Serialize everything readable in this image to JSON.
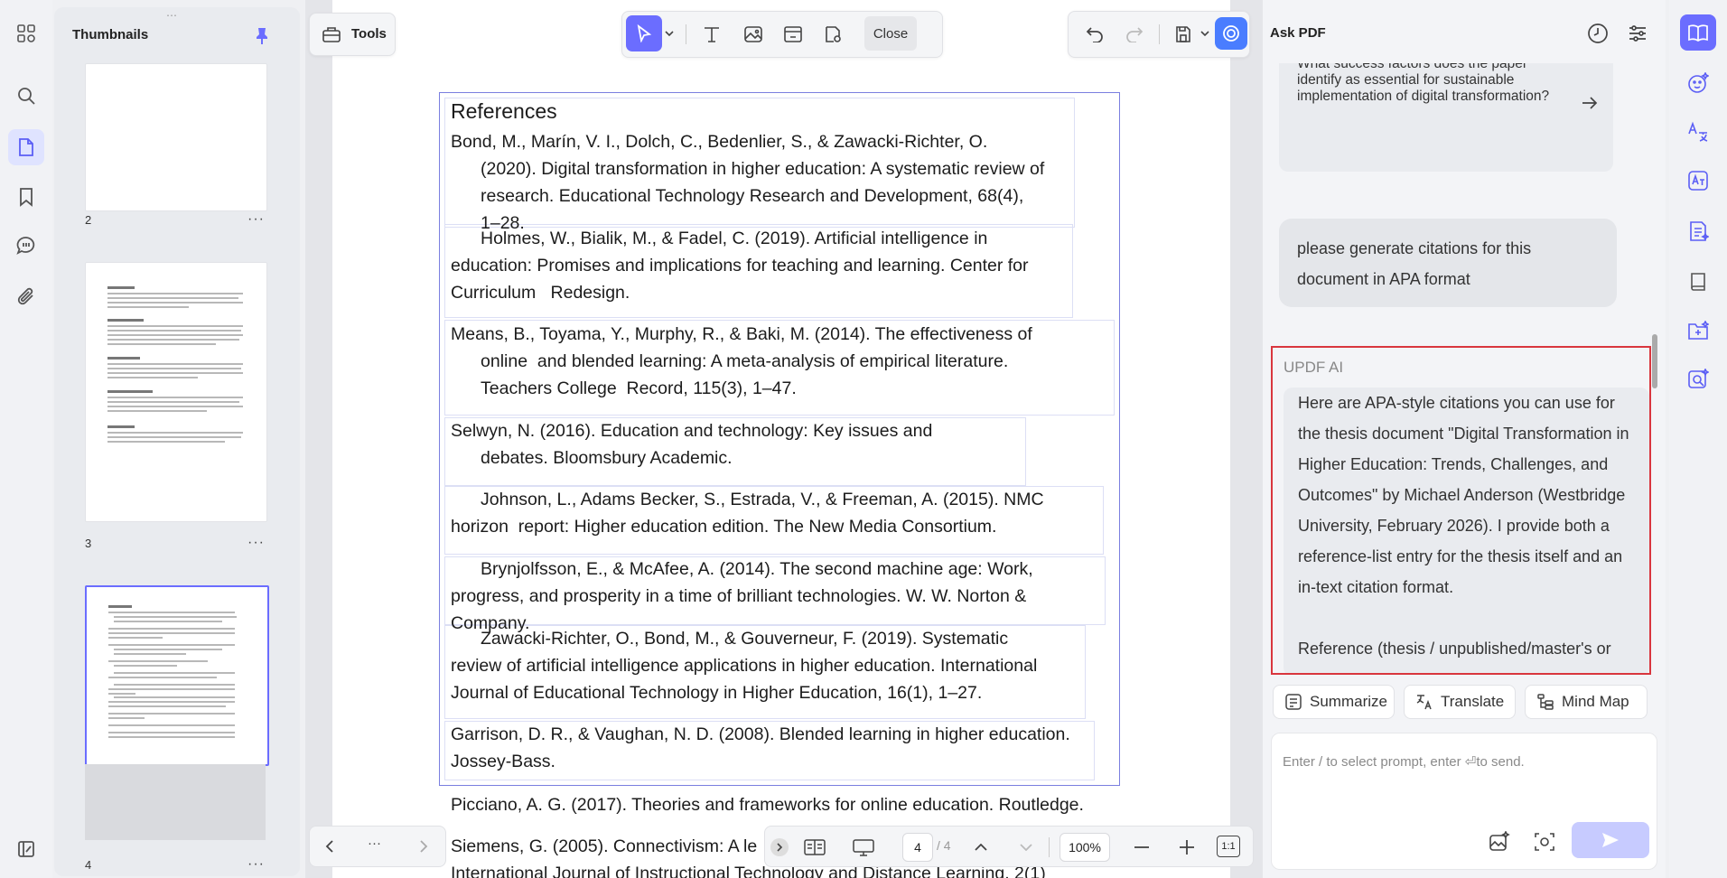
{
  "colors": {
    "accent": "#6b6dff",
    "highlight_border": "#d9363e",
    "ref_frame": "#7a7fe0"
  },
  "thumbnails": {
    "title": "Thumbnails",
    "pages": [
      {
        "number": "2",
        "more": "···"
      },
      {
        "number": "3",
        "more": "···"
      },
      {
        "number": "4",
        "more": "···"
      }
    ]
  },
  "toolbar": {
    "tools_label": "Tools",
    "close_label": "Close"
  },
  "document": {
    "heading": "References",
    "refs": [
      "Bond, M., Marín, V. I., Dolch, C., Bedenlier, S., & Zawacki-Richter, O.",
      "(2020). Digital transformation in higher education: A systematic review of",
      "research. Educational Technology Research and Development, 68(4),",
      "1–28.",
      "Holmes, W., Bialik, M., & Fadel, C. (2019). Artificial intelligence in",
      "education: Promises and implications for teaching and learning. Center for",
      "Curriculum   Redesign.",
      "Means, B., Toyama, Y., Murphy, R., & Baki, M. (2014). The effectiveness of",
      "online  and blended learning: A meta-analysis of empirical literature.",
      "Teachers College  Record, 115(3), 1–47.",
      "Selwyn, N. (2016). Education and technology: Key issues and",
      "debates. Bloomsbury Academic.",
      "Johnson, L., Adams Becker, S., Estrada, V., & Freeman, A. (2015). NMC",
      "horizon  report: Higher education edition. The New Media Consortium.",
      "Brynjolfsson, E., & McAfee, A. (2014). The second machine age: Work,",
      "progress, and prosperity in a time of brilliant technologies. W. W. Norton &",
      "Company.",
      "Zawacki-Richter, O., Bond, M., & Gouverneur, F. (2019). Systematic",
      "review of artificial intelligence applications in higher education. International",
      "Journal of Educational Technology in Higher Education, 16(1), 1–27.",
      "Garrison, D. R., & Vaughan, N. D. (2008). Blended learning in higher education.",
      "Jossey-Bass.",
      "Picciano, A. G. (2017). Theories and frameworks for online education. Routledge.",
      "Siemens, G. (2005). Connectivism: A le",
      "International Journal of Instructional Technology and Distance Learning, 2(1)"
    ]
  },
  "page_nav": {
    "more": "···",
    "current_page": "4",
    "total_pages": "/ 4",
    "zoom": "100%",
    "fit_label": "1:1"
  },
  "ask_pdf": {
    "title": "Ask PDF",
    "suggested_question": "What success factors does the paper identify as essential for sustainable implementation of digital transformation?",
    "user_message": "please generate citations for this document in APA format",
    "ai_label": "UPDF AI",
    "ai_response": "Here are APA-style citations you can use for the thesis document \"Digital Transformation in Higher Education: Trends, Challenges, and Outcomes\" by Michael Anderson (Westbridge University, February 2026). I provide both a reference-list entry for the thesis itself and an in-text citation format.",
    "ai_response_tail": "Reference (thesis / unpublished/master's or",
    "summarize_label": "Summarize",
    "translate_label": "Translate",
    "mindmap_label": "Mind Map",
    "input_placeholder": "Enter / to select prompt, enter ⏎to send."
  }
}
